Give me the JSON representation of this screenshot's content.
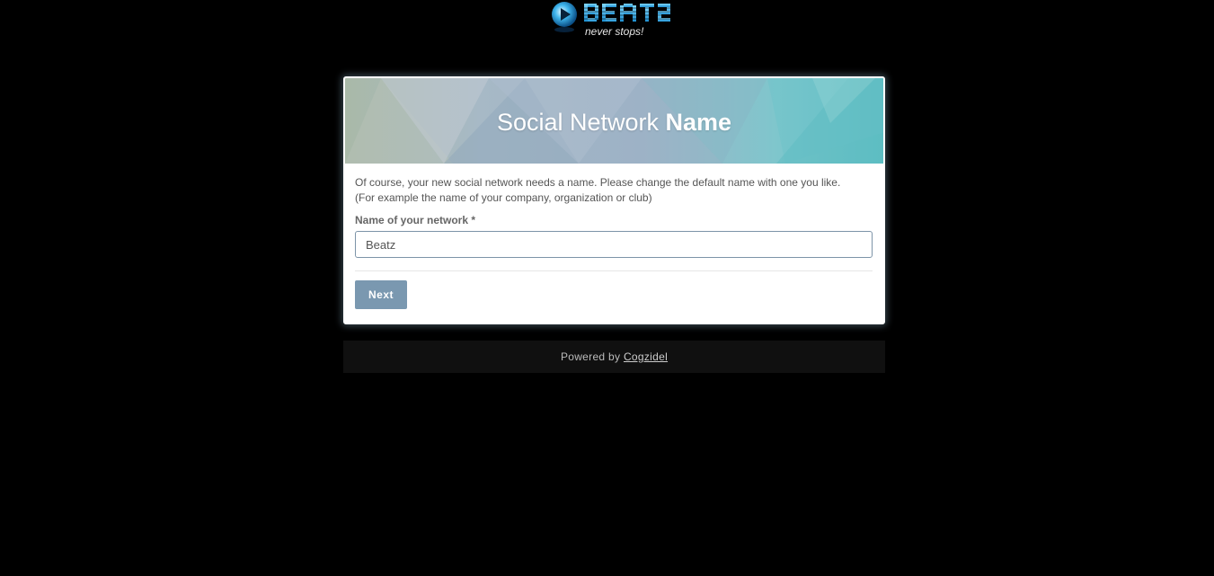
{
  "logo": {
    "wordmark": "BEATZ",
    "tagline": "never stops!"
  },
  "banner": {
    "title_light": "Social Network",
    "title_bold": "Name"
  },
  "form": {
    "description_line1": "Of course, your new social network needs a name. Please change the default name with one you like.",
    "description_line2": "(For example the name of your company, organization or club)",
    "field_label": "Name of your network *",
    "field_value": "Beatz",
    "next_label": "Next"
  },
  "footer": {
    "powered_by": "Powered by",
    "link_text": "Cogzidel"
  },
  "colors": {
    "background": "#000000",
    "button": "#7a98b0",
    "banner_accent": "#5fbfc4"
  }
}
